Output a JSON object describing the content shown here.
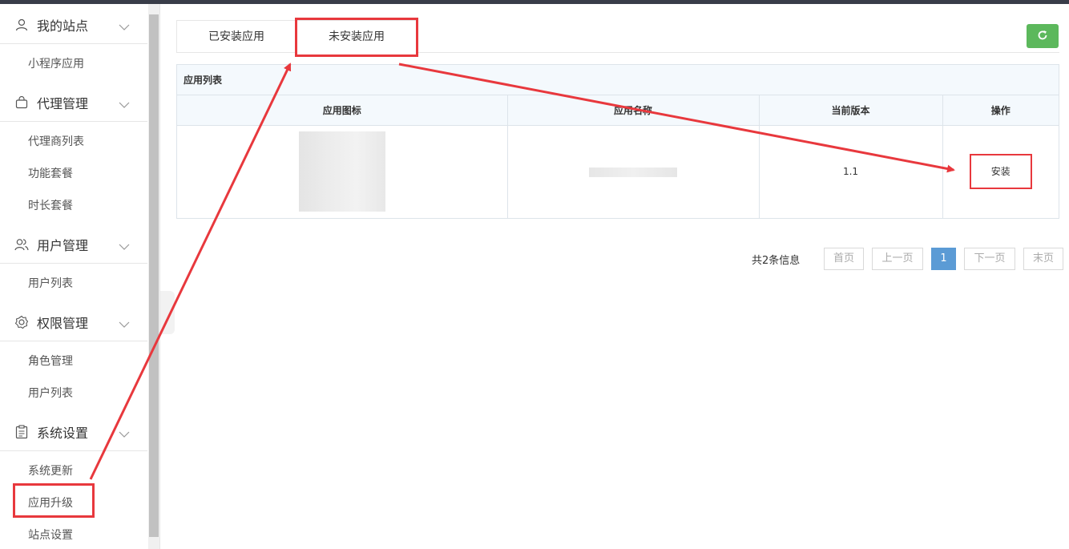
{
  "sidebar": {
    "groups": [
      {
        "label": "我的站点",
        "icon": "user-icon",
        "items": [
          "小程序应用"
        ]
      },
      {
        "label": "代理管理",
        "icon": "bag-icon",
        "items": [
          "代理商列表",
          "功能套餐",
          "时长套餐"
        ]
      },
      {
        "label": "用户管理",
        "icon": "users-icon",
        "items": [
          "用户列表"
        ]
      },
      {
        "label": "权限管理",
        "icon": "gear-icon",
        "items": [
          "角色管理",
          "用户列表"
        ]
      },
      {
        "label": "系统设置",
        "icon": "clipboard-icon",
        "items": [
          "系统更新",
          "应用升级",
          "站点设置"
        ]
      }
    ]
  },
  "tabs": {
    "installed": "已安装应用",
    "uninstalled": "未安装应用",
    "active": "uninstalled"
  },
  "panel": {
    "title": "应用列表",
    "columns": [
      "应用图标",
      "应用名称",
      "当前版本",
      "操作"
    ],
    "rows": [
      {
        "version": "1.1",
        "action": "安装"
      }
    ]
  },
  "pagination": {
    "total_text": "共2条信息",
    "first": "首页",
    "prev": "上一页",
    "current": "1",
    "next": "下一页",
    "last": "末页"
  },
  "colors": {
    "accent_green": "#5cb85c",
    "highlight_red": "#e8383d",
    "page_blue": "#5b9bd5"
  }
}
